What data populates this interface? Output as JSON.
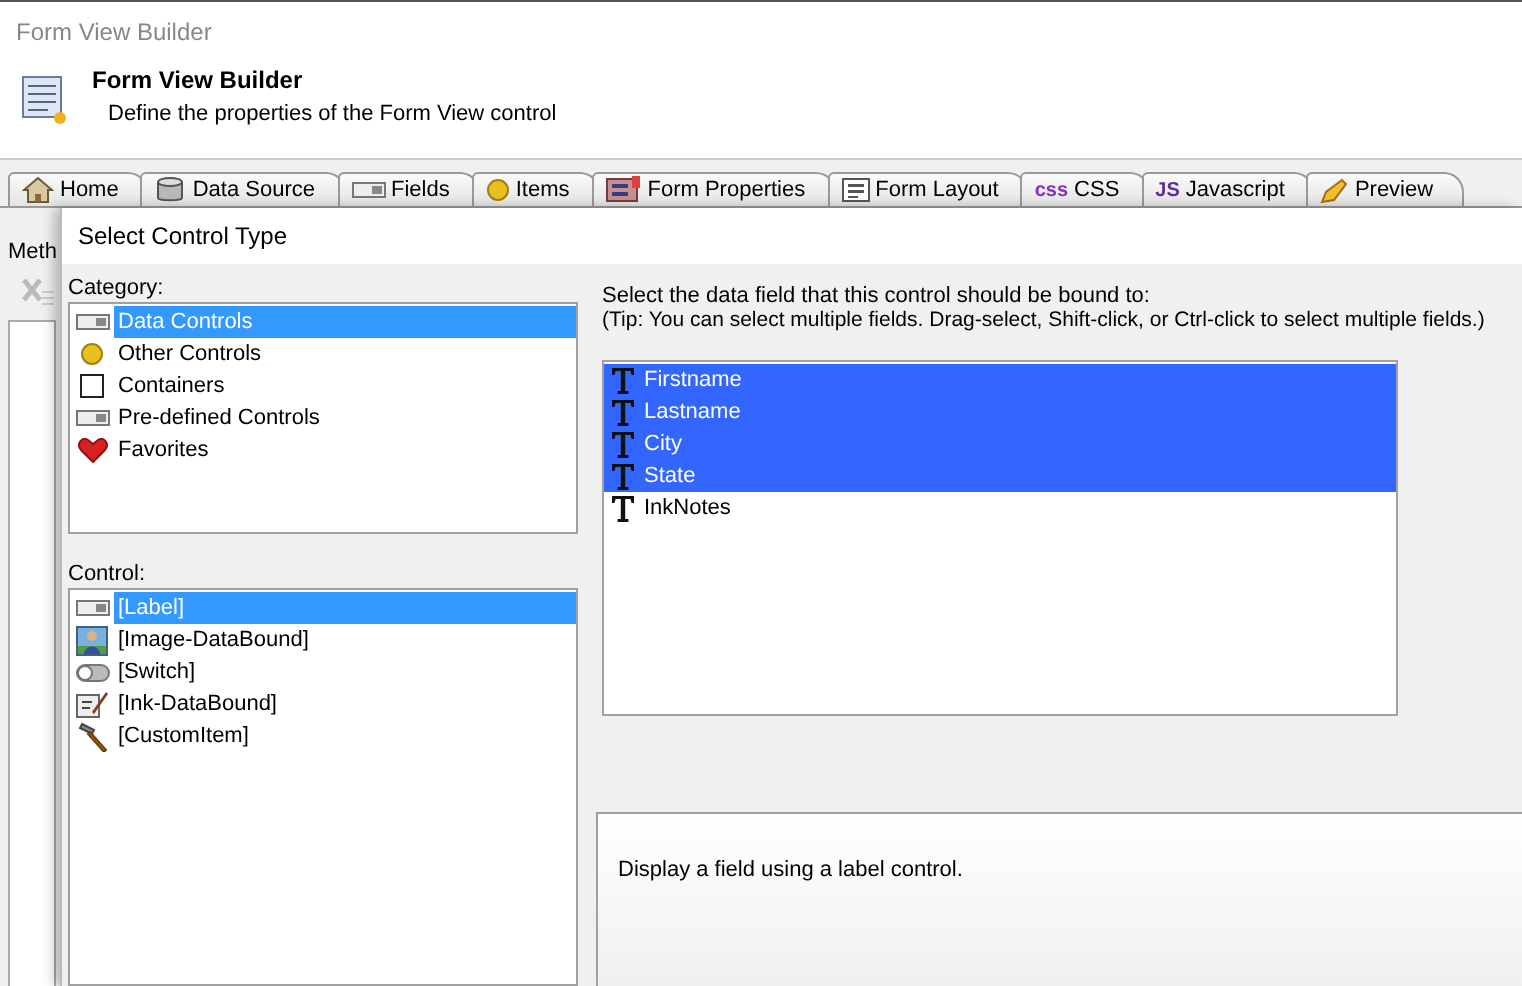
{
  "window": {
    "title": "Form View Builder"
  },
  "header": {
    "title": "Form View Builder",
    "subtitle": "Define the properties of the Form View control"
  },
  "tabs": [
    {
      "label": "Home",
      "kind": "house"
    },
    {
      "label": "Data Source",
      "kind": "database"
    },
    {
      "label": "Fields",
      "kind": "field"
    },
    {
      "label": "Items",
      "kind": "circle"
    },
    {
      "label": "Form Properties",
      "kind": "form"
    },
    {
      "label": "Form Layout",
      "kind": "layout"
    },
    {
      "label": "CSS",
      "kind": "text",
      "icon_text": "css"
    },
    {
      "label": "Javascript",
      "kind": "text",
      "icon_text": "JS"
    },
    {
      "label": "Preview",
      "kind": "pencil"
    }
  ],
  "side_label": "Meth",
  "dialog": {
    "title": "Select Control Type",
    "category_label": "Category:",
    "categories": [
      {
        "label": "Data Controls",
        "kind": "field",
        "selected": true
      },
      {
        "label": "Other Controls",
        "kind": "circle",
        "selected": false
      },
      {
        "label": "Containers",
        "kind": "square",
        "selected": false
      },
      {
        "label": "Pre-defined Controls",
        "kind": "field",
        "selected": false
      },
      {
        "label": "Favorites",
        "kind": "heart",
        "selected": false
      }
    ],
    "control_label": "Control:",
    "controls": [
      {
        "label": "[Label]",
        "kind": "field",
        "selected": true
      },
      {
        "label": "[Image-DataBound]",
        "kind": "image",
        "selected": false
      },
      {
        "label": "[Switch]",
        "kind": "switch",
        "selected": false
      },
      {
        "label": "[Ink-DataBound]",
        "kind": "ink",
        "selected": false
      },
      {
        "label": "[CustomItem]",
        "kind": "hammer",
        "selected": false
      }
    ],
    "instruction": "Select the data field that this control should be bound to:",
    "tip": "(Tip: You can select multiple fields. Drag-select, Shift-click, or Ctrl-click to select multiple fields.)",
    "fields": [
      {
        "label": "Firstname",
        "selected": true
      },
      {
        "label": "Lastname",
        "selected": true
      },
      {
        "label": "City",
        "selected": true
      },
      {
        "label": "State",
        "selected": true
      },
      {
        "label": "InkNotes",
        "selected": false
      }
    ],
    "description": "Display a field using a label control."
  }
}
